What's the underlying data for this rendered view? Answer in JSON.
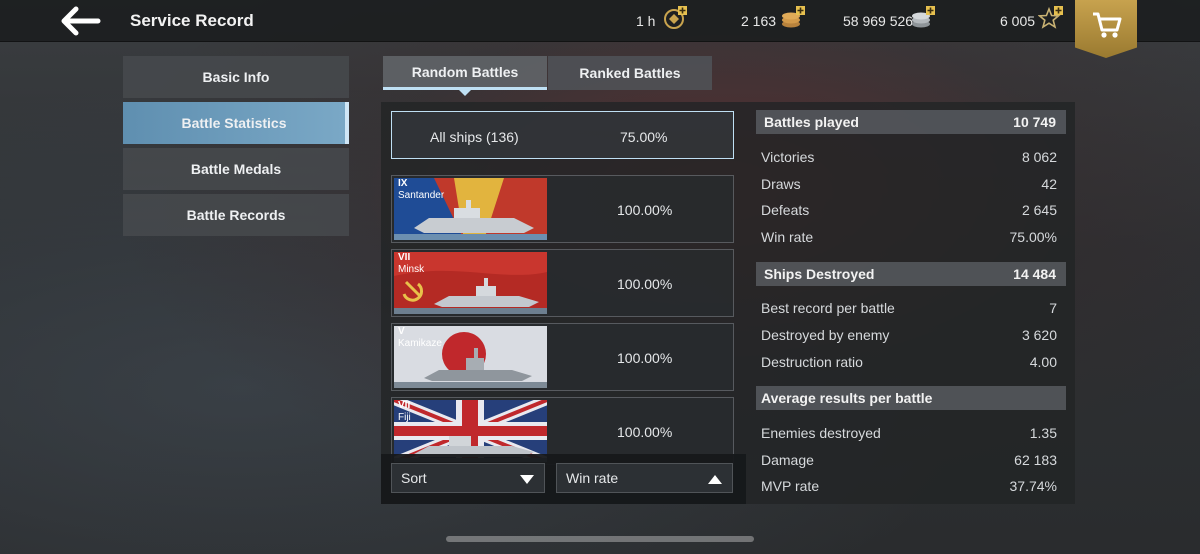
{
  "header": {
    "title": "Service Record",
    "resources": [
      {
        "value": "1 h",
        "icon": "premium-time-icon"
      },
      {
        "value": "2 163",
        "icon": "doubloons-icon"
      },
      {
        "value": "58 969 526",
        "icon": "credits-icon"
      },
      {
        "value": "6 005",
        "icon": "free-xp-icon"
      }
    ],
    "shop_icon": "cart-icon"
  },
  "menu": {
    "items": [
      {
        "label": "Basic Info"
      },
      {
        "label": "Battle Statistics"
      },
      {
        "label": "Battle Medals"
      },
      {
        "label": "Battle Records"
      }
    ],
    "active_index": 1
  },
  "tabs": [
    {
      "label": "Random Battles"
    },
    {
      "label": "Ranked Battles"
    }
  ],
  "ships": {
    "all": {
      "label": "All ships (136)",
      "value": "75.00%"
    },
    "list": [
      {
        "tier": "IX",
        "name": "Santander",
        "value": "100.00%",
        "flag": "spain"
      },
      {
        "tier": "VII",
        "name": "Minsk",
        "value": "100.00%",
        "flag": "ussr"
      },
      {
        "tier": "V",
        "name": "Kamikaze",
        "value": "100.00%",
        "flag": "japan"
      },
      {
        "tier": "VII",
        "name": "Fiji",
        "value": "100.00%",
        "flag": "uk"
      }
    ]
  },
  "sort": {
    "label": "Sort",
    "value": "Win rate"
  },
  "stats": {
    "battles": {
      "label": "Battles played",
      "value": "10 749"
    },
    "battle_rows": [
      {
        "label": "Victories",
        "value": "8 062"
      },
      {
        "label": "Draws",
        "value": "42"
      },
      {
        "label": "Defeats",
        "value": "2 645"
      },
      {
        "label": "Win rate",
        "value": "75.00%"
      }
    ],
    "destroyed": {
      "label": "Ships Destroyed",
      "value": "14 484"
    },
    "destroyed_rows": [
      {
        "label": "Best record per battle",
        "value": "7"
      },
      {
        "label": "Destroyed by enemy",
        "value": "3 620"
      },
      {
        "label": "Destruction ratio",
        "value": "4.00"
      }
    ],
    "average": {
      "label": "Average results per battle"
    },
    "average_rows": [
      {
        "label": "Enemies destroyed",
        "value": "1.35"
      },
      {
        "label": "Damage",
        "value": "62 183"
      },
      {
        "label": "MVP rate",
        "value": "37.74%"
      }
    ]
  },
  "colors": {
    "accent": "#bfe0f4",
    "active_menu": "#6e9fc0",
    "gold": "#c7a24e"
  }
}
